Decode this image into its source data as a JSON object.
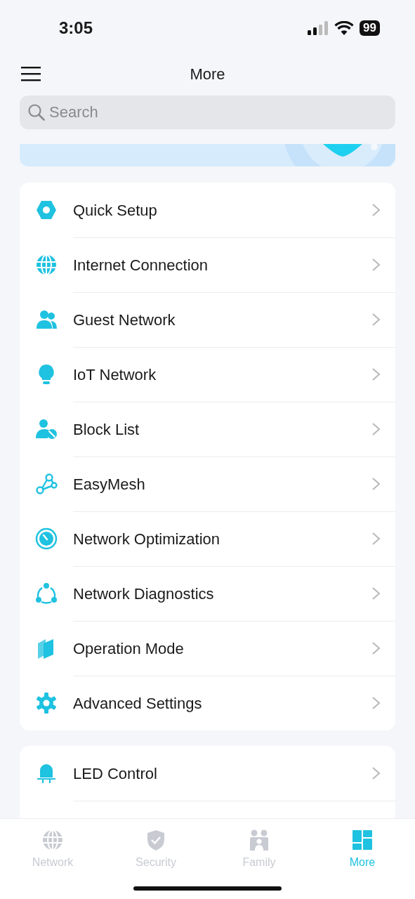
{
  "status_bar": {
    "time": "3:05",
    "battery": "99"
  },
  "header": {
    "title": "More"
  },
  "search": {
    "placeholder": "Search"
  },
  "sections": [
    {
      "items": [
        {
          "label": "Quick Setup",
          "kind": "hexagon"
        },
        {
          "label": "Internet Connection",
          "kind": "globe"
        },
        {
          "label": "Guest Network",
          "kind": "people"
        },
        {
          "label": "IoT Network",
          "kind": "bulb"
        },
        {
          "label": "Block List",
          "kind": "blocked"
        },
        {
          "label": "EasyMesh",
          "kind": "mesh"
        },
        {
          "label": "Network Optimization",
          "kind": "gauge"
        },
        {
          "label": "Network Diagnostics",
          "kind": "nodes"
        },
        {
          "label": "Operation Mode",
          "kind": "panels"
        },
        {
          "label": "Advanced Settings",
          "kind": "gear"
        }
      ]
    },
    {
      "items": [
        {
          "label": "LED Control",
          "kind": "led"
        }
      ]
    }
  ],
  "tab_bar": [
    {
      "label": "Network",
      "kind": "globe",
      "selected": false
    },
    {
      "label": "Security",
      "kind": "shield",
      "selected": false
    },
    {
      "label": "Family",
      "kind": "family",
      "selected": false
    },
    {
      "label": "More",
      "kind": "grid",
      "selected": true
    }
  ]
}
